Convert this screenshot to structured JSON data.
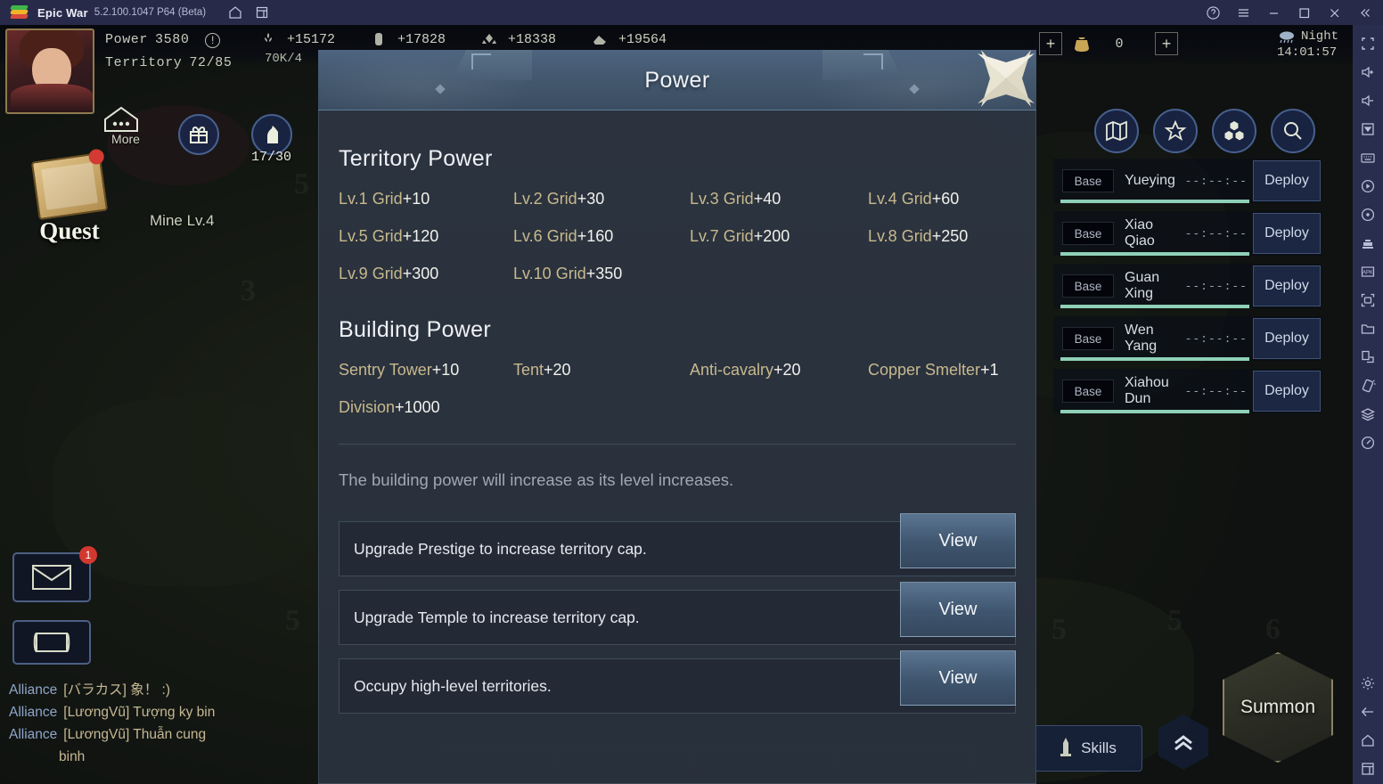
{
  "titlebar": {
    "app_name": "Epic War",
    "version": "5.2.100.1047 P64 (Beta)",
    "home_icon": "home-icon",
    "multi_instance_icon": "multi-instance-icon",
    "help_icon": "help-icon",
    "menu_icon": "menu-icon",
    "minimize_icon": "minimize-icon",
    "maximize_icon": "maximize-icon",
    "close_icon": "close-icon",
    "collapse_icon": "collapse-sidebar-icon"
  },
  "hud": {
    "power_label": "Power",
    "power_value": "3580",
    "territory_label": "Territory",
    "territory_value": "72/85",
    "alert_icon": "exclamation-icon",
    "resources": [
      {
        "icon": "wheat-icon",
        "value": "+15172"
      },
      {
        "icon": "wood-icon",
        "value": "+17828"
      },
      {
        "icon": "stone-icon",
        "value": "+18338"
      },
      {
        "icon": "iron-icon",
        "value": "+19564"
      }
    ],
    "resource_sub": "70K/4",
    "gold_value": "0",
    "gold_icon": "gold-sack-icon",
    "plus_label": "+",
    "weather_icon": "rain-cloud-icon",
    "time_of_day": "Night",
    "clock": "14:01:57",
    "more_label": "More",
    "more_icon": "house-icon",
    "gift_icon": "gift-icon",
    "knight_icon": "knight-icon",
    "knight_count": "17/30",
    "quest_label": "Quest",
    "quest_icon": "quest-book-icon",
    "mine_label": "Mine Lv.4",
    "mail_icon": "mail-icon",
    "mail_badge": "1",
    "scroll_icon": "scroll-icon",
    "tile_numbers": [
      "5",
      "3",
      "5",
      "5",
      "5",
      "5",
      "6"
    ]
  },
  "top_right_icons": [
    {
      "name": "map-icon"
    },
    {
      "name": "star-icon"
    },
    {
      "name": "hex-cluster-icon"
    },
    {
      "name": "search-icon"
    }
  ],
  "heroes": {
    "base_label": "Base",
    "timer_placeholder": "--:--:--",
    "deploy_label": "Deploy",
    "rows": [
      {
        "name": "Yueying"
      },
      {
        "name": "Xiao Qiao"
      },
      {
        "name": "Guan Xing"
      },
      {
        "name": "Wen Yang"
      },
      {
        "name": "Xiahou Dun"
      }
    ]
  },
  "chat": {
    "channel_label": "Alliance",
    "lines": [
      {
        "channel": "Alliance",
        "message": "[バラカス] 象！ :)"
      },
      {
        "channel": "Alliance",
        "message": "[LươngVũ] Tượng ky bin"
      },
      {
        "channel": "Alliance",
        "message": "[LươngVũ] Thuẫn cung"
      }
    ],
    "continuation": "binh"
  },
  "bottom_bar": {
    "skills_label": "Skills",
    "skills_icon": "sword-icon",
    "chevron_icon": "double-chevron-up-icon",
    "summon_label": "Summon",
    "summon_icon": "summon-beast-icon"
  },
  "modal": {
    "title": "Power",
    "close_icon": "close-shuriken-icon",
    "territory_section": {
      "title": "Territory Power",
      "items": [
        {
          "key": "Lv.1 Grid",
          "value": "+10"
        },
        {
          "key": "Lv.2 Grid",
          "value": "+30"
        },
        {
          "key": "Lv.3 Grid",
          "value": "+40"
        },
        {
          "key": "Lv.4 Grid",
          "value": "+60"
        },
        {
          "key": "Lv.5 Grid",
          "value": "+120"
        },
        {
          "key": "Lv.6 Grid",
          "value": "+160"
        },
        {
          "key": "Lv.7 Grid",
          "value": "+200"
        },
        {
          "key": "Lv.8 Grid",
          "value": "+250"
        },
        {
          "key": "Lv.9 Grid",
          "value": "+300"
        },
        {
          "key": "Lv.10 Grid",
          "value": "+350"
        }
      ]
    },
    "building_section": {
      "title": "Building Power",
      "items": [
        {
          "key": "Sentry Tower",
          "value": "+10"
        },
        {
          "key": "Tent",
          "value": "+20"
        },
        {
          "key": "Anti-cavalry",
          "value": "+20"
        },
        {
          "key": "Copper Smelter",
          "value": "+1"
        },
        {
          "key": "Division",
          "value": "+1000"
        }
      ]
    },
    "note": "The building power will increase as its level increases.",
    "actions": [
      {
        "text": "Upgrade Prestige to increase territory cap.",
        "button": "View"
      },
      {
        "text": "Upgrade Temple to increase territory cap.",
        "button": "View"
      },
      {
        "text": "Occupy high-level territories.",
        "button": "View"
      }
    ]
  },
  "sidebar": {
    "items": [
      {
        "name": "fullscreen-icon"
      },
      {
        "name": "volume-up-icon"
      },
      {
        "name": "volume-down-icon"
      },
      {
        "name": "upload-icon"
      },
      {
        "name": "keyboard-icon"
      },
      {
        "name": "record-icon"
      },
      {
        "name": "sync-icon"
      },
      {
        "name": "macro-icon"
      },
      {
        "name": "apk-install-icon"
      },
      {
        "name": "screenshot-icon"
      },
      {
        "name": "folder-icon"
      },
      {
        "name": "rotate-screen-icon"
      },
      {
        "name": "shake-icon"
      },
      {
        "name": "layers-icon"
      },
      {
        "name": "performance-icon"
      }
    ],
    "bottom_items": [
      {
        "name": "settings-gear-icon"
      },
      {
        "name": "back-arrow-icon"
      },
      {
        "name": "home-icon"
      },
      {
        "name": "recent-apps-icon"
      }
    ]
  },
  "colors": {
    "titlebar_bg": "#272b49",
    "sidebar_bg": "#2a2e4e",
    "modal_header": "#44596f",
    "modal_body": "#2c3440",
    "key_gold": "#c8b98d",
    "accent_blue": "#5a7490",
    "badge_red": "#d2382f",
    "hero_bar": "#8fd1b8"
  }
}
